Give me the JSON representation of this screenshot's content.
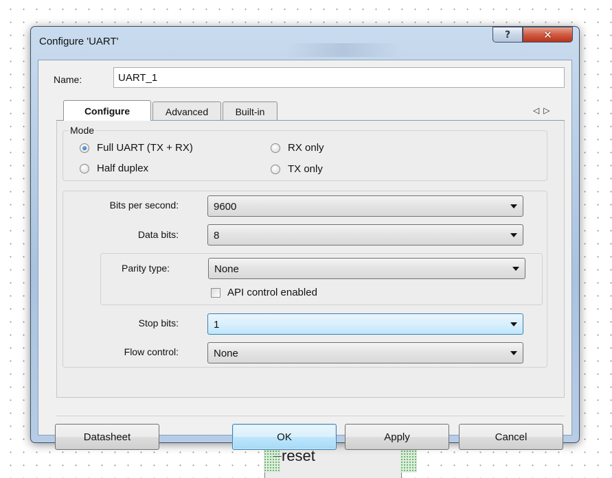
{
  "background": {
    "block_label": "reset"
  },
  "window": {
    "title": "Configure 'UART'",
    "help_glyph": "?",
    "close_glyph": "✕"
  },
  "name_field": {
    "label": "Name:",
    "value": "UART_1"
  },
  "tabs": [
    {
      "label": "Configure",
      "selected": true
    },
    {
      "label": "Advanced",
      "selected": false
    },
    {
      "label": "Built-in",
      "selected": false
    }
  ],
  "tab_scroll": {
    "left_glyph": "◁",
    "right_glyph": "▷"
  },
  "mode": {
    "label": "Mode",
    "options": [
      {
        "label": "Full UART (TX + RX)",
        "checked": true
      },
      {
        "label": "Half duplex",
        "checked": false
      },
      {
        "label": "RX only",
        "checked": false
      },
      {
        "label": "TX only",
        "checked": false
      }
    ]
  },
  "fields": {
    "bits_per_second": {
      "label": "Bits per second:",
      "value": "9600"
    },
    "data_bits": {
      "label": "Data bits:",
      "value": "8"
    },
    "parity_type": {
      "label": "Parity type:",
      "value": "None"
    },
    "api_control": {
      "label": "API control enabled",
      "checked": false
    },
    "stop_bits": {
      "label": "Stop bits:",
      "value": "1"
    },
    "flow_control": {
      "label": "Flow control:",
      "value": "None"
    }
  },
  "buttons": {
    "datasheet": "Datasheet",
    "ok": "OK",
    "apply": "Apply",
    "cancel": "Cancel"
  },
  "colors": {
    "accent_focus": "#3c7fb1",
    "close_button": "#cf5b43",
    "title_bar": "#b7cde7"
  }
}
